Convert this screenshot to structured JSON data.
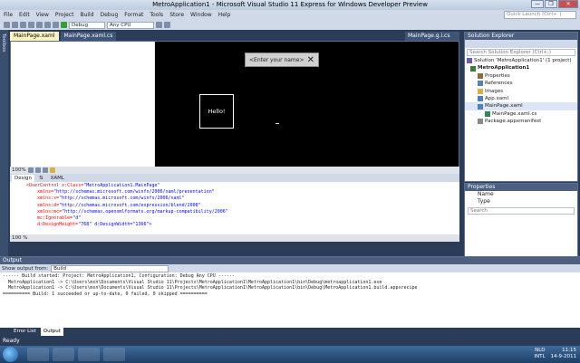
{
  "window": {
    "title": "MetroApplication1 - Microsoft Visual Studio 11 Express for Windows Developer Preview",
    "controls": [
      "—",
      "❐",
      "✕"
    ]
  },
  "menu": [
    "File",
    "Edit",
    "View",
    "Project",
    "Build",
    "Debug",
    "Format",
    "Tools",
    "Store",
    "Window",
    "Help"
  ],
  "quick_launch": {
    "placeholder": "Quick Launch (Ctrl+`)"
  },
  "toolbar": {
    "config": "Debug",
    "platform": "Any CPU"
  },
  "toolbox": {
    "label": "Toolbox"
  },
  "doc_tabs": [
    {
      "label": "MainPage.xaml",
      "active": true
    },
    {
      "label": "MainPage.xaml.cs",
      "active": false
    }
  ],
  "right_tab": {
    "label": "MainPage.g.i.cs"
  },
  "designer": {
    "flyout_text": "<Enter your name>",
    "flyout_close": "✕",
    "hello_text": "Hello!",
    "zoom": "100%"
  },
  "split": {
    "design_label": "Design",
    "swap": "⇅",
    "xaml_label": "XAML"
  },
  "code_lines": [
    {
      "tag": "<UserControl",
      "attr": " x:Class=",
      "val": "\"MetroApplication1.MainPage\""
    },
    {
      "tag": "",
      "attr": "    xmlns=",
      "val": "\"http://schemas.microsoft.com/winfx/2006/xaml/presentation\""
    },
    {
      "tag": "",
      "attr": "    xmlns:x=",
      "val": "\"http://schemas.microsoft.com/winfx/2006/xaml\""
    },
    {
      "tag": "",
      "attr": "    xmlns:d=",
      "val": "\"http://schemas.microsoft.com/expression/blend/2008\""
    },
    {
      "tag": "",
      "attr": "    xmlns:mc=",
      "val": "\"http://schemas.openxmlformats.org/markup-compatibility/2006\""
    },
    {
      "tag": "",
      "attr": "    mc:Ignorable=",
      "val": "\"d\""
    },
    {
      "tag": "",
      "attr": "    d:DesignHeight=",
      "val": "\"768\" d:DesignWidth=\"1366\">"
    }
  ],
  "code_zoom": "100 %",
  "solution_explorer": {
    "title": "Solution Explorer",
    "search_placeholder": "Search Solution Explorer (Ctrl+;)",
    "items": [
      {
        "label": "Solution 'MetroApplication1' (1 project)",
        "indent": 2,
        "icon": "solution-icon",
        "color": "#6d5aa8",
        "bold": false
      },
      {
        "label": "MetroApplication1",
        "indent": 6,
        "icon": "project-icon",
        "color": "#3b7d3b",
        "bold": true
      },
      {
        "label": "Properties",
        "indent": 14,
        "icon": "properties-icon",
        "color": "#8a6d3b",
        "bold": false
      },
      {
        "label": "References",
        "indent": 14,
        "icon": "references-icon",
        "color": "#5a7fb0",
        "bold": false
      },
      {
        "label": "Images",
        "indent": 14,
        "icon": "folder-icon",
        "color": "#d8b144",
        "bold": false
      },
      {
        "label": "App.xaml",
        "indent": 14,
        "icon": "xaml-file-icon",
        "color": "#4f7fbf",
        "bold": false
      },
      {
        "label": "MainPage.xaml",
        "indent": 14,
        "icon": "xaml-file-icon",
        "color": "#4f7fbf",
        "bold": false
      },
      {
        "label": "MainPage.xaml.cs",
        "indent": 22,
        "icon": "cs-file-icon",
        "color": "#2f8a4f",
        "bold": false
      },
      {
        "label": "Package.appxmanifest",
        "indent": 14,
        "icon": "manifest-icon",
        "color": "#888888",
        "bold": false
      }
    ]
  },
  "properties": {
    "title": "Properties",
    "name_label": "Name",
    "type_label": "Type",
    "search_placeholder": "Search"
  },
  "output": {
    "title": "Output",
    "show_label": "Show output from:",
    "source": "Build",
    "lines": [
      "------ Build started: Project: MetroApplication1, Configuration: Debug Any CPU ------",
      "  MetroApplication1 -> C:\\Users\\msn\\Documents\\Visual Studio 11\\Projects\\MetroApplication1\\MetroApplication1\\bin\\Debug\\metroapplication1.exe",
      "  MetroApplication1 -> C:\\Users\\msn\\Documents\\Visual Studio 11\\Projects\\MetroApplication1\\MetroApplication1\\bin\\Debug\\MetroApplication1.build.appxrecipe",
      "========== Build: 1 succeeded or up-to-date, 0 failed, 0 skipped =========="
    ]
  },
  "bottom_tabs": [
    {
      "label": "Error List",
      "active": false
    },
    {
      "label": "Output",
      "active": true
    }
  ],
  "status": "Ready",
  "tray": {
    "lang": "NLD",
    "layout": "INTL",
    "time": "11:15",
    "date": "14-9-2011"
  },
  "colors": {
    "accent": "#2b3c58",
    "canvas": "#000000",
    "active_tab": "#fff4c1"
  }
}
